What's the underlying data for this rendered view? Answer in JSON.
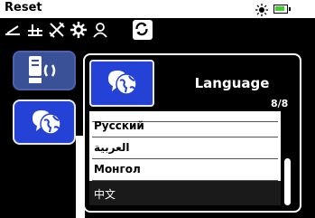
{
  "header": {
    "title": "Reset"
  },
  "status": {
    "sun_icon": "brightness-icon",
    "battery_icon": "battery-icon",
    "battery_color": "#3fcf2a"
  },
  "toolbar": {
    "icons": [
      "ground-balance-icon",
      "notch-icon",
      "tools-icon",
      "settings-gear-icon",
      "user-icon",
      "reset-icon"
    ]
  },
  "tiles": {
    "manual": {
      "icon": "manual-volume-icon"
    },
    "language": {
      "icon": "language-globe-chat-icon"
    }
  },
  "dialog": {
    "title": "Language",
    "count": "8/8",
    "items": [
      {
        "label": ""
      },
      {
        "label": "Русский"
      },
      {
        "label": "العربية"
      },
      {
        "label": "Монгол"
      },
      {
        "label": "中文"
      }
    ],
    "selected_index": 4
  },
  "colors": {
    "accent_blue": "#2442d6",
    "tile_muted": "#3b5197"
  }
}
